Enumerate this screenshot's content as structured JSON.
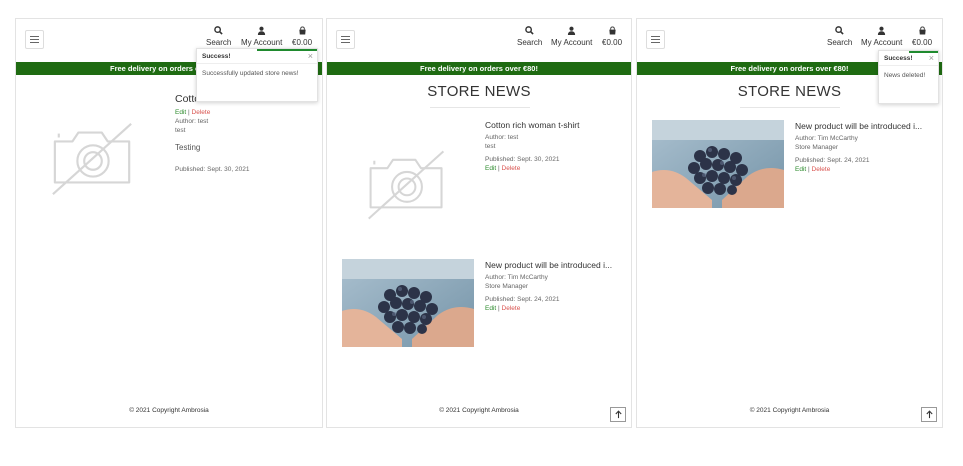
{
  "nav": {
    "search_label": "Search",
    "account_label": "My Account",
    "cart_label": "€0.00"
  },
  "banner_text": "Free delivery on orders over €80!",
  "store_news_title": "STORE NEWS",
  "footer_text": "© 2021 Copyright Ambrosia",
  "colors": {
    "banner": "#1f6b12",
    "edit_link": "#2b8a2b",
    "delete_link": "#d9534f",
    "toast_accent": "#1f8a2e"
  },
  "panel1": {
    "toast": {
      "title": "Success!",
      "close": "×",
      "message": "Successfully updated store news!"
    },
    "article": {
      "title": "Cotton rich woman t-shirt",
      "edit": "Edit",
      "sep": "|",
      "delete": "Delete",
      "author": "Author: test",
      "role": "test",
      "body": "Testing",
      "published": "Published: Sept. 30, 2021"
    }
  },
  "panel2": {
    "articles": [
      {
        "title": "Cotton rich woman t-shirt",
        "author": "Author: test",
        "role": "test",
        "published": "Published: Sept. 30, 2021",
        "edit": "Edit",
        "sep": "|",
        "delete": "Delete"
      },
      {
        "title": "New product will be introduced i...",
        "author": "Author: Tim McCarthy",
        "role": "Store Manager",
        "published": "Published: Sept. 24, 2021",
        "edit": "Edit",
        "sep": "|",
        "delete": "Delete"
      }
    ],
    "totop_icon": "arrow-up-icon"
  },
  "panel3": {
    "toast": {
      "title": "Success!",
      "close": "×",
      "message": "News deleted!"
    },
    "article": {
      "title": "New product will be introduced i...",
      "author": "Author: Tim McCarthy",
      "role": "Store Manager",
      "published": "Published: Sept. 24, 2021",
      "edit": "Edit",
      "sep": "|",
      "delete": "Delete"
    },
    "totop_icon": "arrow-up-icon"
  }
}
